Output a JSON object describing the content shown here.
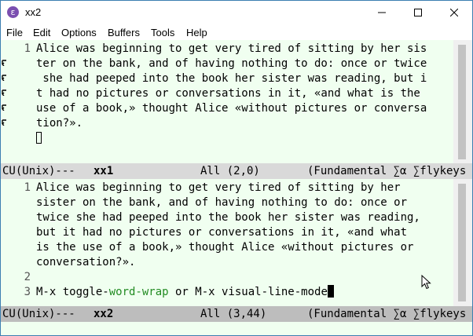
{
  "window": {
    "title": "xx2",
    "app_icon": "emacs-icon"
  },
  "menu": [
    "File",
    "Edit",
    "Options",
    "Buffers",
    "Tools",
    "Help"
  ],
  "pane_top": {
    "line_number": "1",
    "lines": [
      "Alice was beginning to get very tired of sitting by her sis",
      "ter on the bank, and of having nothing to do: once or twice",
      " she had peeped into the book her sister was reading, but i",
      "t had no pictures or conversations in it, «and what is the ",
      "use of a book,» thought Alice «without pictures or conversa",
      "tion?»."
    ],
    "modeline": {
      "coding": "CU(Unix)---",
      "buffer": "xx1",
      "position": "All (2,0)",
      "modes": "(Fundamental ∑α ∑flykeys"
    }
  },
  "pane_bottom": {
    "line_numbers": [
      "1",
      "2",
      "3"
    ],
    "lines": [
      "Alice was beginning to get very tired of sitting by her",
      "sister on the bank, and of having nothing to do: once or",
      "twice she had peeped into the book her sister was reading,",
      "but it had no pictures or conversations in it, «and what",
      "is the use of a book,» thought Alice «without pictures or",
      "conversation?»."
    ],
    "command_line": {
      "part1": "M-x toggle-",
      "keyword": "word-wrap",
      "part2": " or M-x visual-line-mode"
    },
    "modeline": {
      "coding": "CU(Unix)---",
      "buffer": "xx2",
      "position": "All (3,44)",
      "modes": "(Fundamental ∑α ∑flykeys"
    }
  },
  "colors": {
    "buffer_bg": "#f0fff0",
    "keyword": "#228b22",
    "modeline_active": "#bdbdbd",
    "modeline_inactive": "#d9d9d9"
  }
}
